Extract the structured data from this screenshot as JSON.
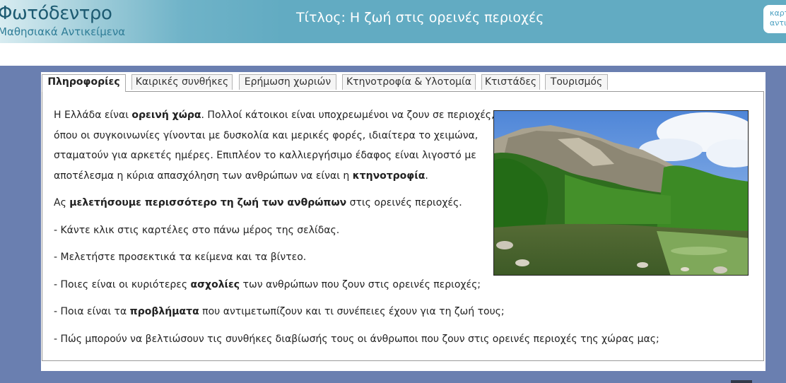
{
  "header": {
    "logo_title": "Φωτόδεντρο",
    "logo_subtitle": "Μαθησιακά Αντικείμενα",
    "title": "Τίτλος:  Η ζωή στις ορεινές περιοχές",
    "corner_line1": "καρτ",
    "corner_line2": "αντι"
  },
  "tabs": [
    {
      "label": "Πληροφορίες",
      "active": true
    },
    {
      "label": "Καιρικές συνθήκες",
      "active": false
    },
    {
      "label": "Ερήμωση χωριών",
      "active": false
    },
    {
      "label": "Κτηνοτροφία & Υλοτομία",
      "active": false
    },
    {
      "label": "Κτιστάδες",
      "active": false
    },
    {
      "label": "Τουρισμός",
      "active": false
    }
  ],
  "content": {
    "p1_a": "Η Ελλάδα είναι ",
    "p1_b": "ορεινή χώρα",
    "p1_c": ". Πολλοί κάτοικοι είναι υποχρεωμένοι να ζουν σε περιοχές,",
    "p1_line2": "όπου οι συγκοινωνίες γίνονται με δυσκολία και μερικές φορές, ιδιαίτερα το χειμώνα,",
    "p1_line3": "σταματούν για αρκετές ημέρες. Επιπλέον το καλλιεργήσιμο έδαφος είναι λιγοστό με",
    "p1_line4_a": "αποτέλεσμα η κύρια απασχόληση των ανθρώπων να είναι η ",
    "p1_line4_b": "κτηνοτροφία",
    "p1_line4_c": ".",
    "p2_a": "Ας ",
    "p2_b": "μελετήσουμε περισσότερο τη ζωή των ανθρώπων",
    "p2_c": " στις ορεινές περιοχές.",
    "b1": "- Κάντε κλικ στις καρτέλες στο πάνω μέρος της σελίδας.",
    "b2": "- Μελετήστε προσεκτικά τα κείμενα και τα βίντεο.",
    "b3_a": "- Ποιες είναι οι κυριότερες ",
    "b3_b": "ασχολίες",
    "b3_c": " των ανθρώπων που ζουν στις ορεινές περιοχές;",
    "b4_a": "- Ποια είναι τα ",
    "b4_b": "προβλήματα",
    "b4_c": " που αντιμετωπίζουν και τι συνέπειες έχουν για τη ζωή τους;",
    "b5": "- Πώς μπορούν να βελτιώσουν τις συνθήκες διαβίωσής τους οι άνθρωποι που ζουν στις ορεινές περιοχές της χώρας μας;"
  },
  "colors": {
    "header_bg": "#62abc2",
    "page_bg": "#6a7fb0",
    "logo_text": "#1d5b72"
  }
}
